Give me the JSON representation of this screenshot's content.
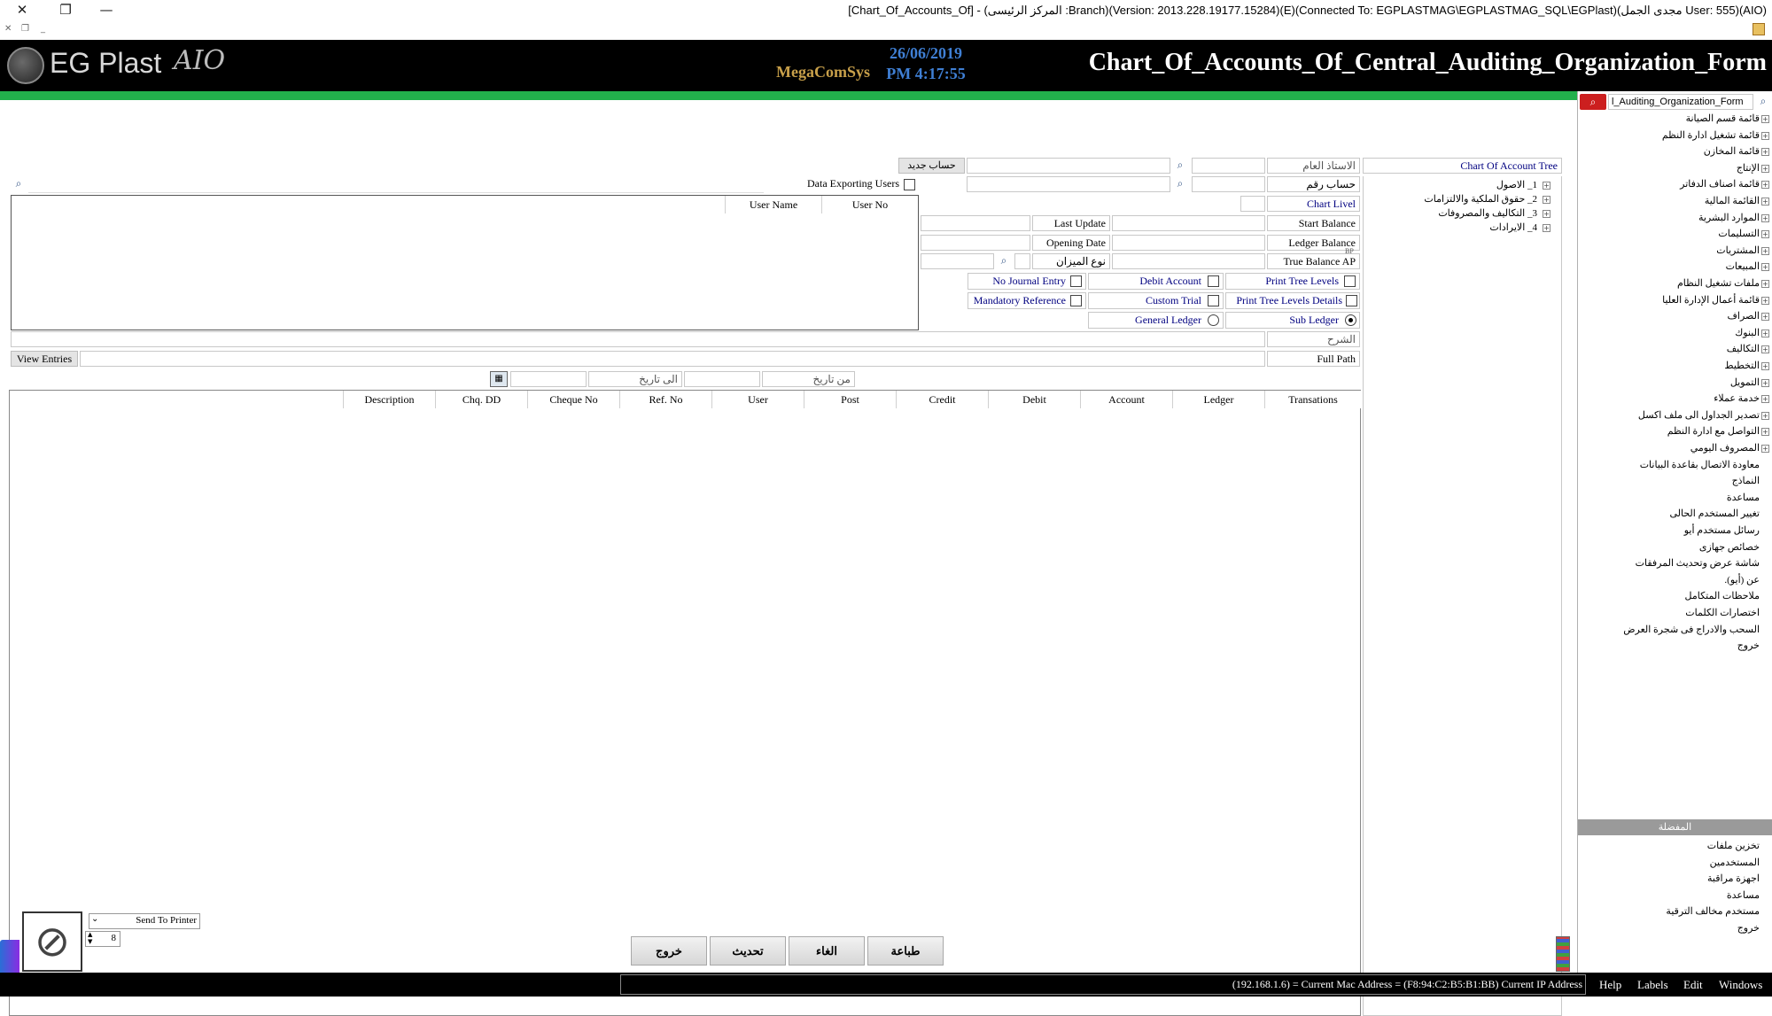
{
  "window": {
    "title": "[Chart_Of_Accounts_Of] - (المركز الرئيسى :Branch)(Version: 2013.228.19177.15284)(E)(Connected To: EGPLASTMAG\\EGPLASTMAG_SQL\\EGPlast)(مجدى الجمل User: 555)(AIO)"
  },
  "header": {
    "logo_text": "EG Plast",
    "logo_suffix": "AIO",
    "brand": "MegaComSys",
    "date": "26/06/2019",
    "time": "PM 4:17:55",
    "form_title": "Chart_Of_Accounts_Of_Central_Auditing_Organization_Form"
  },
  "form": {
    "chart_tree_label": "Chart Of Account Tree",
    "general_master_label": "الاستاذ العام",
    "new_account_label": "حساب جديد",
    "account_no_label": "حساب رقم",
    "chart_level_label": "Chart Livel",
    "start_balance_label": "Start Balance",
    "last_update_label": "Last Update",
    "ledger_balance_label": "Ledger Balance",
    "opening_date_label": "Opening Date",
    "true_balance_label": "True Balance AP",
    "balance_type_label": "نوع الميزان",
    "print_tree_levels_label": "Print Tree Levels",
    "debit_account_label": "Debit Account",
    "no_journal_entry_label": "No Journal Entry",
    "print_tree_levels_details_label": "Print Tree Levels Details",
    "custom_trial_label": "Custom Trial",
    "mandatory_reference_label": "Mandatory Reference",
    "sub_ledger_label": "Sub Ledger",
    "general_ledger_label": "General Ledger",
    "explanation_label": "الشرح",
    "full_path_label": "Full Path",
    "view_entries_label": "View Entries",
    "from_date_label": "من تاريخ",
    "to_date_label": "الى تاريخ",
    "data_exporting_users_label": "Data Exporting Users",
    "bp_mark": "BP"
  },
  "users_table": {
    "columns": [
      "User No",
      "User Name"
    ]
  },
  "entries_table": {
    "columns": [
      "Transations",
      "Ledger",
      "Account",
      "Debit",
      "Credit",
      "Post",
      "User",
      "Ref. No",
      "Cheque No",
      "Chq. DD",
      "Description"
    ]
  },
  "tree": {
    "items": [
      "1_ الاصول",
      "2_ حقوق الملكية والالتزامات",
      "3_ التكاليف والمصروفات",
      "4_ الايرادات"
    ]
  },
  "bottom": {
    "send_to_printer_label": "Send To Printer",
    "copies": "8",
    "print_label": "طباعة",
    "cancel_label": "الغاء",
    "refresh_label": "تحديث",
    "exit_label": "خروج"
  },
  "sidebar": {
    "search_value": "l_Auditing_Organization_Form",
    "menu_items": [
      {
        "label": "قائمة قسم الصيانة",
        "expand": true
      },
      {
        "label": "قائمة تشغيل ادارة النظم",
        "expand": true
      },
      {
        "label": "قائمة المخازن",
        "expand": true
      },
      {
        "label": "الإنتاج",
        "expand": true
      },
      {
        "label": "قائمة اصناف الدفاتر",
        "expand": true
      },
      {
        "label": "القائمة المالية",
        "expand": true
      },
      {
        "label": "الموارد البشرية",
        "expand": true
      },
      {
        "label": "التسليمات",
        "expand": true
      },
      {
        "label": "المشتريات",
        "expand": true
      },
      {
        "label": "المبيعات",
        "expand": true
      },
      {
        "label": "ملفات تشغيل النظام",
        "expand": true
      },
      {
        "label": "قائمة أعمال الإدارة العليا",
        "expand": true
      },
      {
        "label": "الصراف",
        "expand": true
      },
      {
        "label": "البنوك",
        "expand": true
      },
      {
        "label": "التكاليف",
        "expand": true
      },
      {
        "label": "التخطيط",
        "expand": true
      },
      {
        "label": "التمويل",
        "expand": true
      },
      {
        "label": "خدمة عملاء",
        "expand": true
      },
      {
        "label": "تصدير الجداول الى ملف اكسل",
        "expand": true
      },
      {
        "label": "التواصل مع ادارة النظم",
        "expand": true
      },
      {
        "label": "المصروف اليومي",
        "expand": true
      },
      {
        "label": "معاودة الاتصال بقاعدة البيانات",
        "expand": false
      },
      {
        "label": "النماذج",
        "expand": false
      },
      {
        "label": "مساعدة",
        "expand": false
      },
      {
        "label": "تغيير المستخدم الحالى",
        "expand": false
      },
      {
        "label": "رسائل مستخدم أيو",
        "expand": false
      },
      {
        "label": "خصائص جهازى",
        "expand": false
      },
      {
        "label": "شاشة عرض وتحديث المرفقات",
        "expand": false
      },
      {
        "label": "عن (أيو).",
        "expand": false
      },
      {
        "label": "ملاحظات المتكامل",
        "expand": false
      },
      {
        "label": "اختصارات الكلمات",
        "expand": false
      },
      {
        "label": "السحب والادراج فى شجرة العرض",
        "expand": false
      },
      {
        "label": "خروج",
        "expand": false
      }
    ],
    "favorites_title": "المفضلة",
    "favorites": [
      "تخزين ملفات",
      "المستخدمين",
      "اجهزة مراقبة",
      "مساعدة",
      "مستخدم مخالف الترقية",
      "خروج"
    ]
  },
  "statusbar": {
    "text": "(192.168.1.6) = Current Mac Address = (F8:94:C2:B5:B1:BB) Current IP Address",
    "menus": [
      "Help",
      "Labels",
      "Edit",
      "Windows"
    ]
  },
  "colors": {
    "header_bg": "#000000",
    "green_bar": "#22b14c",
    "clock": "#3f7fd4",
    "search_button": "#cc1f1f"
  }
}
